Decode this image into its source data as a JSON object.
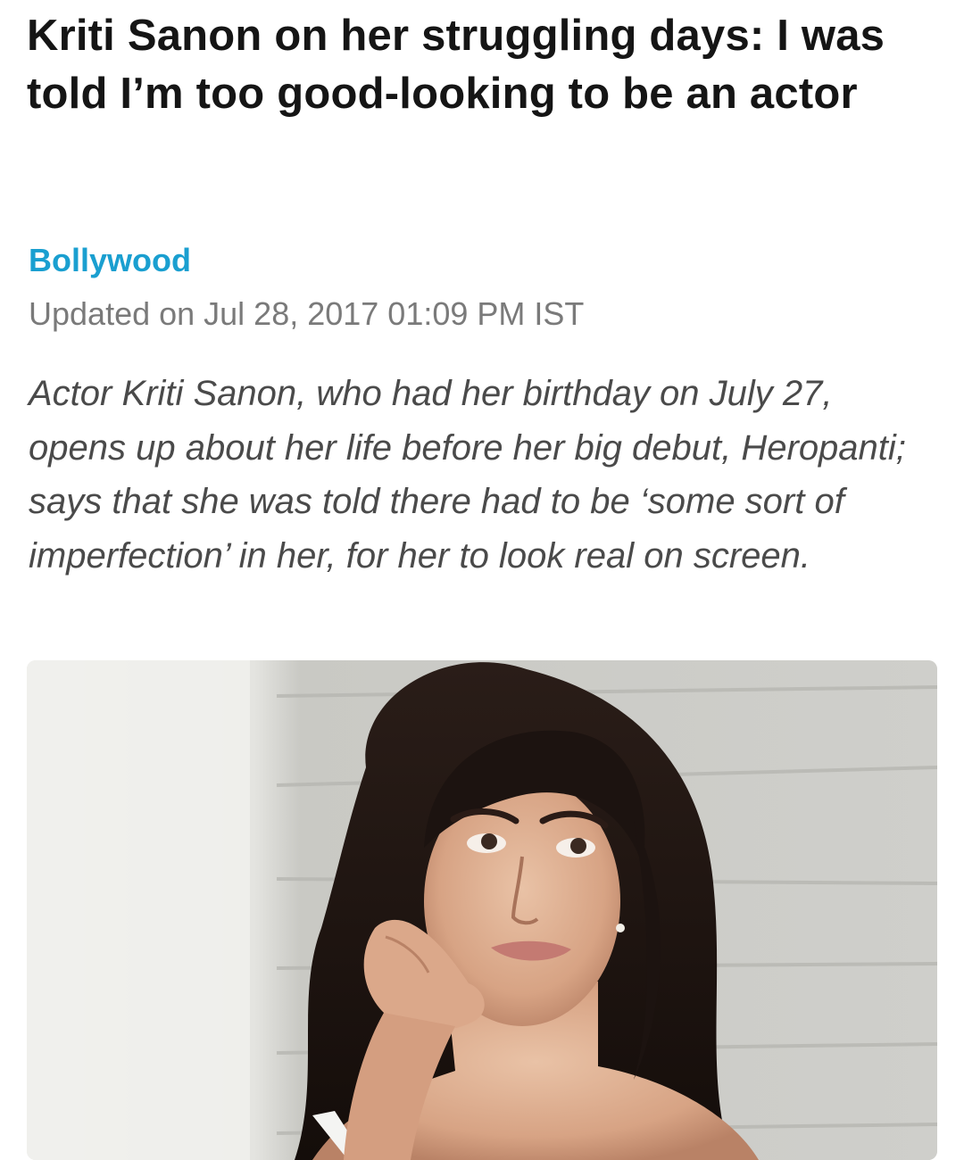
{
  "article": {
    "headline": "Kriti Sanon on her struggling days: I was told I’m too good-looking to be an actor",
    "category": "Bollywood",
    "updated": "Updated on Jul 28, 2017 01:09 PM IST",
    "summary": "Actor Kriti Sanon, who had her birthday on July 27, opens up about her life before her big debut, Heropanti; says that she was told there had to be ‘some sort of imperfection’ in her, for her to look real on screen.",
    "image": {
      "subject": "portrait-photo"
    }
  },
  "colors": {
    "category": "#1a9fd0",
    "headline": "#151515",
    "meta": "#7a7a7a",
    "summary": "#4a4a4a"
  }
}
